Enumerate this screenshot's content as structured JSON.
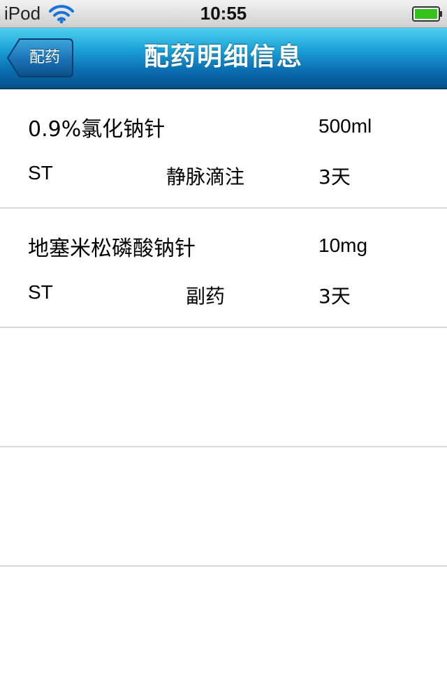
{
  "status_bar": {
    "carrier": "iPod",
    "time": "10:55",
    "wifi_icon": "wifi-icon",
    "battery_icon": "battery-icon",
    "battery_color": "#35c21a"
  },
  "nav": {
    "back_label": "配药",
    "title": "配药明细信息",
    "colors": {
      "top": "#4fd0f0",
      "bottom": "#064f8a"
    }
  },
  "items": [
    {
      "name": "0.9%氯化钠针",
      "dose": "500ml",
      "frequency": "ST",
      "route": "静脉滴注",
      "days": "3天"
    },
    {
      "name": "地塞米松磷酸钠针",
      "dose": "10mg",
      "frequency": "ST",
      "route": "副药",
      "days": "3天"
    },
    {
      "name": "",
      "dose": "",
      "frequency": "",
      "route": "",
      "days": ""
    },
    {
      "name": "",
      "dose": "",
      "frequency": "",
      "route": "",
      "days": ""
    },
    {
      "name": "",
      "dose": "",
      "frequency": "",
      "route": "",
      "days": ""
    }
  ]
}
